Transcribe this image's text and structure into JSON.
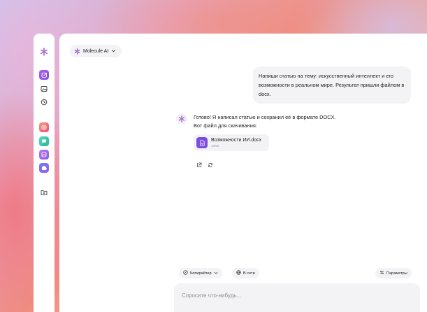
{
  "sidebar": {
    "icons": [
      "molecule-logo-icon",
      "new-chat-icon",
      "image-icon",
      "history-icon",
      "app-instagram-icon",
      "app-chat-icon",
      "app-gallery-icon",
      "app-puzzle-icon",
      "add-folder-icon"
    ],
    "accent": "#8a56e8"
  },
  "header": {
    "model_label": "Molecule AI"
  },
  "chat": {
    "user_message": "Напиши статью на тему: искусственный интеллект и его возможности в реальном мире. Результат пришли файлом в docx.",
    "assistant_line1": "Готово! Я написал статью и сохранил её в формате DOCX.",
    "assistant_line2": "Вот файл для скачивания:",
    "file": {
      "name": "Возможности ИИ.docx",
      "size": "14KB"
    }
  },
  "composer": {
    "mode_label": "Копирайтер",
    "web_label": "В сети",
    "params_label": "Параметры",
    "placeholder": "Спросите что-нибудь..."
  },
  "colors": {
    "accent_purple": "#7c4ee0",
    "bubble_bg": "#f3f3f5"
  }
}
